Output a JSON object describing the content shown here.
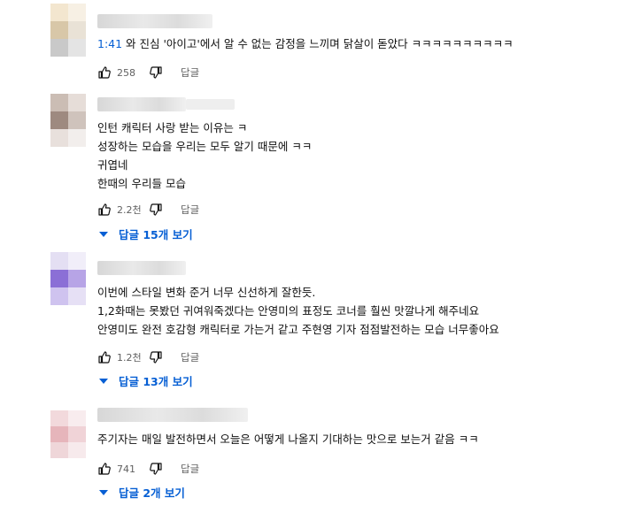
{
  "comments": [
    {
      "lines": [
        " 와 진심 '아이고'에서 알 수 없는 감정을 느끼며 닭살이 돋았다 ㅋㅋㅋㅋㅋㅋㅋㅋㅋㅋ"
      ],
      "timestamp": "1:41",
      "likes": "258",
      "reply_label": "답글"
    },
    {
      "lines": [
        "인턴 캐릭터 사랑 받는 이유는 ㅋ",
        "성장하는 모습을 우리는 모두 알기 때문에 ㅋㅋ",
        "귀엽네",
        "한때의 우리들 모습"
      ],
      "likes": "2.2천",
      "reply_label": "답글",
      "replies_label": "답글 15개 보기"
    },
    {
      "lines": [
        "이번에 스타일 변화 준거 너무 신선하게 잘한듯.",
        "1,2화때는 못봤던 귀여워죽겠다는 안영미의 표정도 코너를 훨씬 맛깔나게 해주네요",
        "안영미도 완전 호감형 캐릭터로 가는거 같고 주현영 기자 점점발전하는 모습 너무좋아요"
      ],
      "likes": "1.2천",
      "reply_label": "답글",
      "replies_label": "답글 13개 보기"
    },
    {
      "lines": [
        "주기자는 매일 발전하면서 오늘은 어떻게 나올지 기대하는 맛으로 보는거 같음 ㅋㅋ"
      ],
      "likes": "741",
      "reply_label": "답글",
      "replies_label": "답글 2개 보기"
    }
  ],
  "icons": {
    "like": "thumbs-up-icon",
    "dislike": "thumbs-down-icon",
    "expand": "caret-down-icon"
  },
  "colors": {
    "link_blue": "#065fd4",
    "meta_gray": "#606060",
    "text": "#0f0f0f"
  }
}
